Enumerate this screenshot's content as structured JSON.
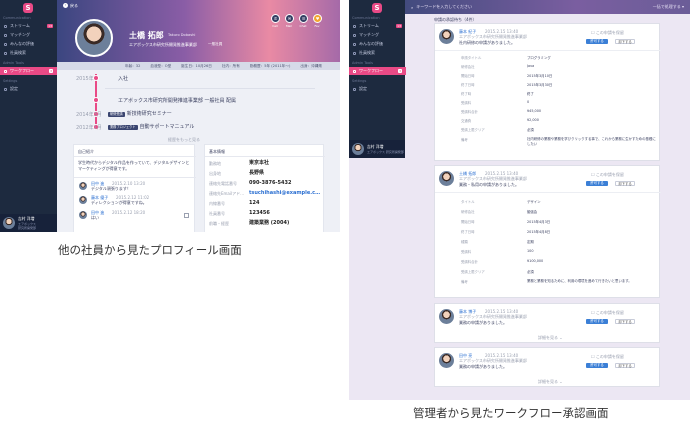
{
  "captions": {
    "left": "他の社員から見たプロフィール画面",
    "right": "管理者から見たワークフロー承認画面"
  },
  "colors": {
    "sidebar": "#1d2a3f",
    "accent_pink": "#e94a86",
    "approve_blue": "#3b7fd6",
    "link_blue": "#2b6fd1"
  },
  "profile_screen": {
    "sidebar": {
      "logo": "S",
      "section_communication": "Communication",
      "items": [
        {
          "label": "ストリーム",
          "badge": "13",
          "icon": "stream-icon"
        },
        {
          "label": "マッチング",
          "badge": "",
          "icon": "matching-icon"
        },
        {
          "label": "みんなの評価",
          "badge": "",
          "icon": "star-icon"
        },
        {
          "label": "社員検索",
          "badge": "",
          "icon": "search-icon"
        },
        {
          "label": "ワークフロー",
          "badge": "3",
          "icon": "workflow-icon"
        }
      ],
      "section_admin": "Admin Tools",
      "section_settings": "Settings",
      "settings_item": "設定",
      "user_name": "吉村 洋増",
      "user_sub1": "エアボックス",
      "user_sub2": "研究所開発部"
    },
    "back_label": "戻る",
    "name": "土橋 拓郎",
    "name_kana": "Takuro Dobashi",
    "company": "エアボックス市研究所開発推進事業部",
    "position_badge": "一般社員",
    "actions": [
      {
        "label": "Call",
        "icon": "phone-icon"
      },
      {
        "label": "Mail",
        "icon": "mail-icon"
      },
      {
        "label": "Chat",
        "icon": "chat-icon"
      },
      {
        "label": "Fav",
        "icon": "heart-icon"
      }
    ],
    "stats": [
      "年齢：32",
      "血液型：O型",
      "誕生日：10月26日",
      "社内：所有",
      "勤務歴：5年 (2011年〜)",
      "出身：沖縄県"
    ],
    "timeline": [
      {
        "year": "2015年",
        "tag": "",
        "text": "入社"
      },
      {
        "year": "",
        "tag": "",
        "text": "エアボックス市研究所開発推進事業部  一般社員  配属"
      },
      {
        "year": "2014年3月",
        "tag": "研修受講",
        "text": "新技術研究セミナー"
      },
      {
        "year": "2012年1月",
        "tag": "業務プロジェクト",
        "text": "自動サポートマニュアル"
      }
    ],
    "timeline_more": "経歴をもっと見る",
    "intro_title": "自己紹介",
    "intro_text": "学生時代からデジタル作品を作っていて、デジタルデザインとマーケティングが得意です。",
    "comments": [
      {
        "name": "田中 進",
        "date": "2015.2.10 13:20",
        "text": "デジタル頑張ります！"
      },
      {
        "name": "藤本 優子",
        "date": "2015.2.12 11:02",
        "text": "ディレクションが得意ですね。"
      },
      {
        "name": "田中 進",
        "date": "2015.2.12 18:20",
        "text": "はい"
      }
    ],
    "info_title": "基本情報",
    "info": [
      {
        "label": "勤務地",
        "value": "東京本社"
      },
      {
        "label": "出身地",
        "value": "長野県"
      },
      {
        "label": "連絡先電話番号",
        "value": "090-3876-5432"
      },
      {
        "label": "連絡先Emailアドレス",
        "value": "tsuchihashi@example.com"
      },
      {
        "label": "内線番号",
        "value": "124"
      },
      {
        "label": "社員番号",
        "value": "123456"
      },
      {
        "label": "前職・経歴",
        "value": "建築業務 (2004)"
      }
    ]
  },
  "workflow_screen": {
    "sidebar": {
      "logo": "S",
      "section_communication": "Communication",
      "items": [
        {
          "label": "ストリーム",
          "badge": "13",
          "icon": "stream-icon"
        },
        {
          "label": "マッチング",
          "badge": "",
          "icon": "matching-icon"
        },
        {
          "label": "みんなの評価",
          "badge": "",
          "icon": "star-icon"
        },
        {
          "label": "社員検索",
          "badge": "",
          "icon": "search-icon"
        }
      ],
      "section_admin": "Admin Tools",
      "admin_item": "ワークフロー",
      "admin_badge": "3",
      "section_settings": "Settings",
      "settings_item": "設定",
      "user_name": "吉村 洋増",
      "user_sub": "エアボックス 研究所開発部"
    },
    "search_placeholder": "キーワードを入力してください",
    "filter_label": "一括で処理する",
    "list_title": "申請の承認待ち（4件）",
    "approve_label": "許可する",
    "reject_label": "却下する",
    "skip_label": "この申請を保留",
    "detail_label": "詳細を見る",
    "requests": [
      {
        "name": "藤本 紀子",
        "date": "2015.2.15 13:40",
        "dept": "エアボックス市研究所開発推進事業部",
        "message": "社内研修の申請がありました。",
        "rows": [
          {
            "label": "申請タイトル",
            "value": "プログラミング"
          },
          {
            "label": "研修会社",
            "value": "Java"
          },
          {
            "label": "開始日時",
            "value": "2015年3月10日"
          },
          {
            "label": "終了日時",
            "value": "2015年3月30日"
          },
          {
            "label": "終了時",
            "value": "終了"
          },
          {
            "label": "受講料",
            "value": "0"
          },
          {
            "label": "受講料合計",
            "value": "¥45,000"
          },
          {
            "label": "交通費",
            "value": "¥2,000"
          },
          {
            "label": "受講上限クリア",
            "value": "必須"
          },
          {
            "label": "備考",
            "value": "社内研修の業務や業務を学びクリックする事で、これから業務に生かすための基礎にしたい"
          }
        ]
      },
      {
        "name": "土橋 拓郎",
        "date": "2015.2.15 13:40",
        "dept": "エアボックス市研究所開発推進事業部",
        "message": "業務・私用の申請がありました。",
        "rows": [
          {
            "label": "タイトル",
            "value": "デザイン"
          },
          {
            "label": "研修会社",
            "value": "勉強会"
          },
          {
            "label": "開始日時",
            "value": "2015年4月3日"
          },
          {
            "label": "終了日時",
            "value": "2015年4月8日"
          },
          {
            "label": "種類",
            "value": "定期"
          },
          {
            "label": "受講料",
            "value": "100"
          },
          {
            "label": "受講料合計",
            "value": "¥100,000"
          },
          {
            "label": "受講上限クリア",
            "value": "必須"
          },
          {
            "label": "備考",
            "value": "業務と業務を知るために、利用の環境を進めて行きたいと思います。"
          }
        ]
      },
      {
        "name": "藤本 博子",
        "date": "2015.2.15 13:40",
        "dept": "エアボックス市研究所開発推進事業部",
        "message": "業務の申請がありました。",
        "rows": []
      },
      {
        "name": "田中 亮",
        "date": "2015.2.15 13:40",
        "dept": "エアボックス市研究所開発推進事業部",
        "message": "業務の申請がありました。",
        "rows": []
      }
    ]
  }
}
